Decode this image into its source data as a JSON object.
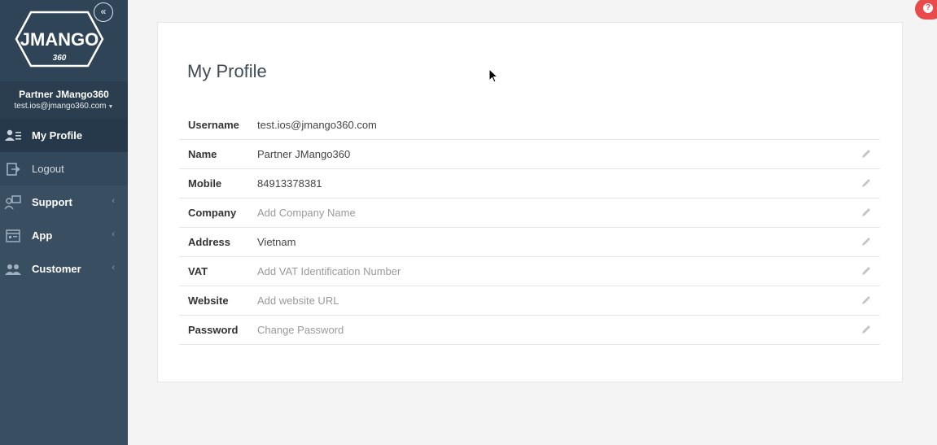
{
  "sidebar": {
    "logo_text": "JMANGO",
    "logo_sub": "360",
    "collapse_glyph": "«",
    "user": {
      "name": "Partner JMango360",
      "email": "test.ios@jmango360.com"
    },
    "items": [
      {
        "label": "My Profile",
        "icon": "profile-icon"
      },
      {
        "label": "Logout",
        "icon": "logout-icon"
      },
      {
        "label": "Support",
        "icon": "support-icon"
      },
      {
        "label": "App",
        "icon": "app-icon"
      },
      {
        "label": "Customer",
        "icon": "customer-icon"
      }
    ]
  },
  "main": {
    "title": "My Profile",
    "rows": [
      {
        "label": "Username",
        "value": "test.ios@jmango360.com",
        "editable": false
      },
      {
        "label": "Name",
        "value": "Partner JMango360",
        "editable": true
      },
      {
        "label": "Mobile",
        "value": "84913378381",
        "editable": true
      },
      {
        "label": "Company",
        "value": "Add Company Name",
        "editable": true
      },
      {
        "label": "Address",
        "value": "Vietnam",
        "editable": true
      },
      {
        "label": "VAT",
        "value": "Add VAT Identification Number",
        "editable": true
      },
      {
        "label": "Website",
        "value": "Add website URL",
        "editable": true
      },
      {
        "label": "Password",
        "value": "Change Password",
        "editable": true
      }
    ]
  },
  "help": {
    "glyph": "?",
    "color": "#e94b4b"
  },
  "colors": {
    "sidebar": "#3a4e62",
    "sidebar_active": "#26394b",
    "accent": "#e94b4b"
  }
}
